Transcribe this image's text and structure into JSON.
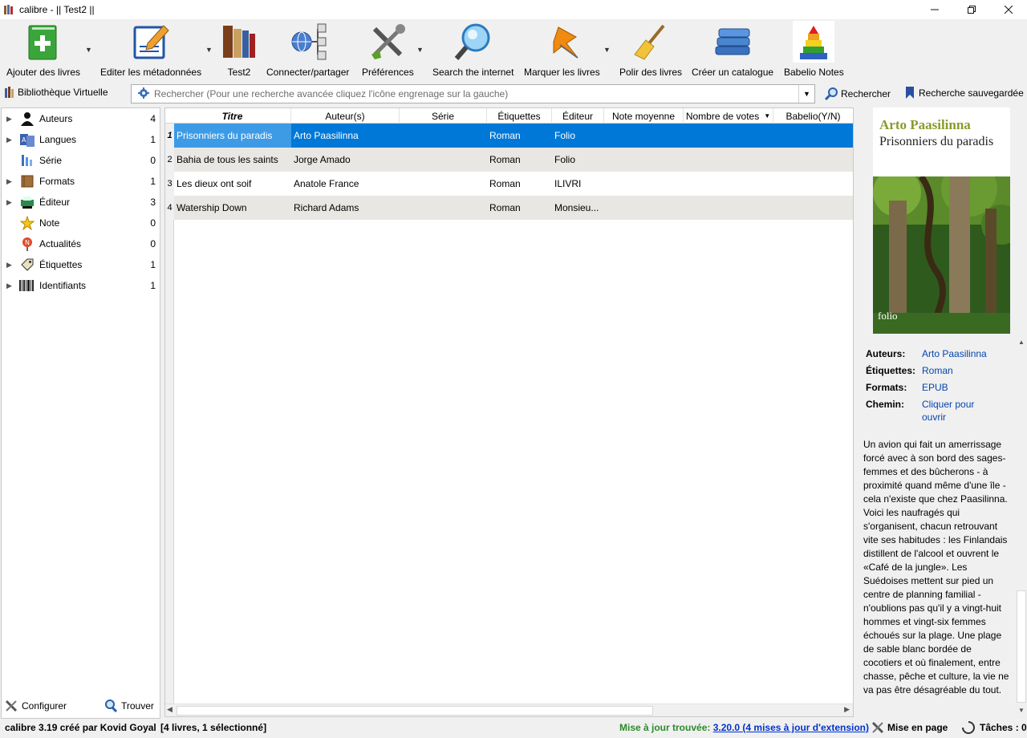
{
  "window": {
    "title": "calibre - || Test2 ||"
  },
  "toolbar": {
    "add_books": "Ajouter des livres",
    "edit_metadata": "Editer les métadonnées",
    "library": "Test2",
    "connect_share": "Connecter/partager",
    "preferences": "Préférences",
    "search_internet": "Search the internet",
    "mark_books": "Marquer les livres",
    "polish_books": "Polir des livres",
    "create_catalog": "Créer un catalogue",
    "babelio_notes": "Babelio Notes"
  },
  "search": {
    "virtual_library": "Bibliothèque Virtuelle",
    "placeholder": "Rechercher (Pour une recherche avancée cliquez l'icône engrenage sur la gauche)",
    "search_button": "Rechercher",
    "saved_search": "Recherche sauvegardée"
  },
  "tag_browser": {
    "items": [
      {
        "label": "Auteurs",
        "count": "4",
        "icon": "person-icon",
        "expandable": true
      },
      {
        "label": "Langues",
        "count": "1",
        "icon": "language-icon",
        "expandable": true
      },
      {
        "label": "Série",
        "count": "0",
        "icon": "series-icon",
        "expandable": false
      },
      {
        "label": "Formats",
        "count": "1",
        "icon": "book-icon",
        "expandable": true
      },
      {
        "label": "Éditeur",
        "count": "3",
        "icon": "publisher-icon",
        "expandable": true
      },
      {
        "label": "Note",
        "count": "0",
        "icon": "star-icon",
        "expandable": false
      },
      {
        "label": "Actualités",
        "count": "0",
        "icon": "news-icon",
        "expandable": false
      },
      {
        "label": "Étiquettes",
        "count": "1",
        "icon": "tag-icon",
        "expandable": true
      },
      {
        "label": "Identifiants",
        "count": "1",
        "icon": "barcode-icon",
        "expandable": true
      }
    ],
    "configure": "Configurer",
    "find": "Trouver"
  },
  "book_list": {
    "columns": [
      "Titre",
      "Auteur(s)",
      "Série",
      "Étiquettes",
      "Éditeur",
      "Note moyenne",
      "Nombre de votes",
      "Babelio(Y/N)"
    ],
    "rows": [
      {
        "num": "1",
        "title": "Prisonniers du paradis",
        "author": "Arto Paasilinna",
        "series": "",
        "tags": "Roman",
        "publisher": "Folio",
        "rating": "",
        "votes": "",
        "babelio": ""
      },
      {
        "num": "2",
        "title": "Bahia de tous les saints",
        "author": "Jorge Amado",
        "series": "",
        "tags": "Roman",
        "publisher": "Folio",
        "rating": "",
        "votes": "",
        "babelio": ""
      },
      {
        "num": "3",
        "title": "Les dieux ont soif",
        "author": "Anatole France",
        "series": "",
        "tags": "Roman",
        "publisher": "ILIVRI",
        "rating": "",
        "votes": "",
        "babelio": ""
      },
      {
        "num": "4",
        "title": "Watership Down",
        "author": "Richard Adams",
        "series": "",
        "tags": "Roman",
        "publisher": "Monsieu...",
        "rating": "",
        "votes": "",
        "babelio": ""
      }
    ],
    "selected_index": 0
  },
  "details": {
    "cover_author": "Arto Paasilinna",
    "cover_title": "Prisonniers du paradis",
    "cover_publisher": "folio",
    "authors_label": "Auteurs:",
    "authors_value": "Arto Paasilinna",
    "tags_label": "Étiquettes:",
    "tags_value": "Roman",
    "formats_label": "Formats:",
    "formats_value": "EPUB",
    "path_label": "Chemin:",
    "path_value": "Cliquer pour ouvrir",
    "description": "Un avion qui fait un amerrissage forcé avec à son bord des sages-femmes et des bûcherons - à proximité quand même d'une île - cela n'existe que chez Paasilinna. Voici les naufragés qui s'organisent, chacun retrouvant vite ses habitudes : les Finlandais distillent de l'alcool et ouvrent le «Café de la jungle». Les Suédoises mettent sur pied un centre de planning familial - n'oublions pas qu'il y a vingt-huit hommes et vingt-six femmes échoués sur la plage. Une plage de sable blanc bordée de cocotiers et où finalement, entre chasse, pêche et culture, la vie ne va pas être désagréable du tout."
  },
  "status": {
    "version": "calibre 3.19 créé par Kovid Goyal",
    "count": "[4 livres, 1 sélectionné]",
    "update_prefix": "Mise à jour trouvée:",
    "update_link": "3.20.0 (4 mises à jour d'extension)",
    "layout": "Mise en page",
    "jobs": "Tâches : 0"
  },
  "colors": {
    "selection": "#0078d7",
    "update_green": "#2c8a2c",
    "link_blue": "#0645ad"
  }
}
